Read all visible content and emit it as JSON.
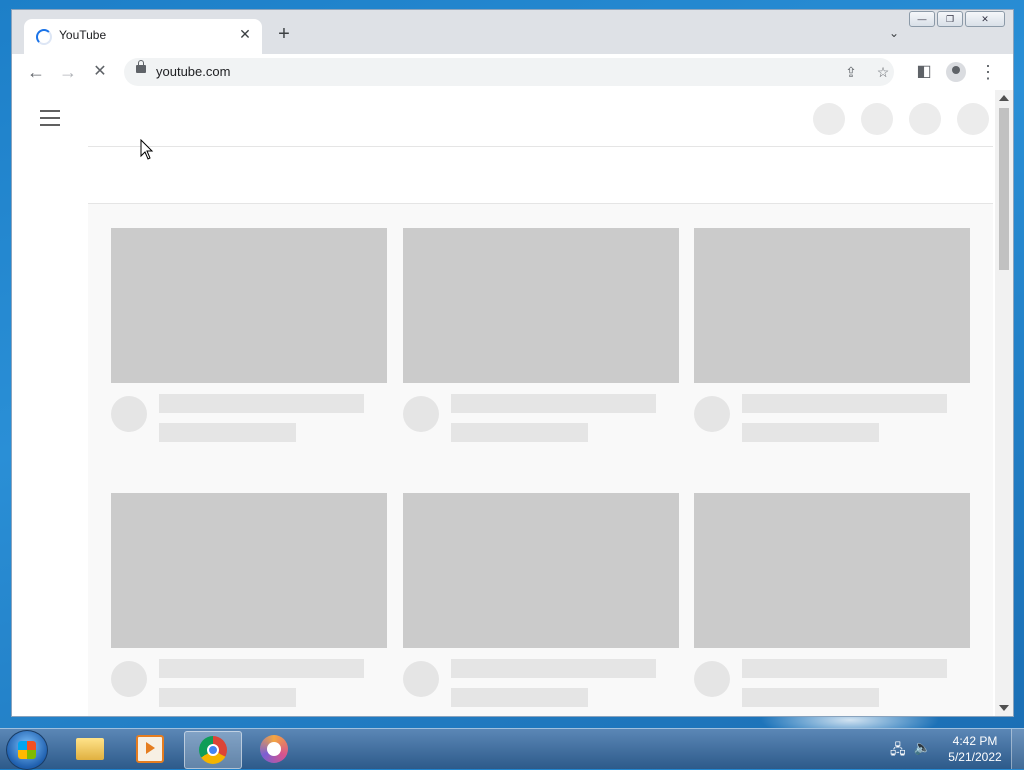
{
  "browser": {
    "tab": {
      "title": "YouTube",
      "close_glyph": "✕"
    },
    "new_tab_glyph": "+",
    "tab_search_glyph": "⌄",
    "window_controls": {
      "minimize": "—",
      "maximize": "❐",
      "close": "✕"
    },
    "toolbar": {
      "back_glyph": "←",
      "forward_glyph": "→",
      "stop_glyph": "✕",
      "url": "youtube.com",
      "share_glyph": "⇪",
      "bookmark_glyph": "☆",
      "sidepanel_glyph": "◧",
      "menu_glyph": "⋮"
    }
  },
  "page": {
    "state": "loading-skeleton",
    "cards": 6
  },
  "taskbar": {
    "items": [
      "file-explorer",
      "media-player",
      "chrome",
      "vpn-app"
    ],
    "active_item": "chrome",
    "clock": {
      "time": "4:42 PM",
      "date": "5/21/2022"
    }
  },
  "colors": {
    "skeleton_thumb": "#cbcbcb",
    "skeleton_line": "#e5e5e5",
    "feed_background": "#f9f9f9",
    "accent": "#1a73e8"
  }
}
